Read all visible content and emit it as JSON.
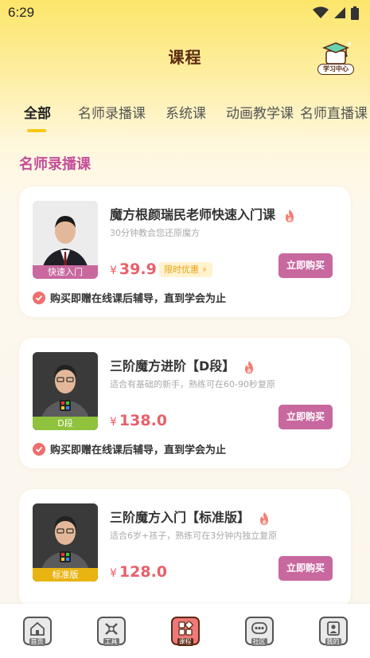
{
  "status": {
    "time": "6:29"
  },
  "header": {
    "title": "课程",
    "study_center_label": "学习中心"
  },
  "tabs": [
    {
      "label": "全部",
      "active": true
    },
    {
      "label": "名师录播课",
      "active": false
    },
    {
      "label": "系统课",
      "active": false
    },
    {
      "label": "动画教学课",
      "active": false
    },
    {
      "label": "名师直播课",
      "active": false
    }
  ],
  "section": {
    "title": "名师录播课"
  },
  "courses": [
    {
      "title": "魔方根颜瑞民老师快速入门课",
      "subtitle": "30分钟教会您还原魔方",
      "price": "39.9",
      "currency": "¥",
      "promo": "限时优惠",
      "tag": "快速入门",
      "tag_color": "#c8689f",
      "buy_label": "立即购买",
      "bonus": "购买即赠在线课后辅导，直到学会为止"
    },
    {
      "title": "三阶魔方进阶【D段】",
      "subtitle": "适合有基础的新手，熟练可在60-90秒复原",
      "price": "138.0",
      "currency": "¥",
      "tag": "D段",
      "tag_color": "#8fc23d",
      "buy_label": "立即购买",
      "bonus": "购买即赠在线课后辅导，直到学会为止"
    },
    {
      "title": "三阶魔方入门【标准版】",
      "subtitle": "适合6岁+孩子，熟练可在3分钟内独立复原",
      "price": "128.0",
      "currency": "¥",
      "tag": "标准版",
      "tag_color": "#e9b312",
      "buy_label": "立即购买"
    }
  ],
  "bottom_nav": [
    {
      "label": "首页",
      "icon": "home-icon",
      "active": false
    },
    {
      "label": "工具",
      "icon": "tools-icon",
      "active": false
    },
    {
      "label": "课程",
      "icon": "course-icon",
      "active": true
    },
    {
      "label": "社区",
      "icon": "community-icon",
      "active": false
    },
    {
      "label": "我的",
      "icon": "profile-icon",
      "active": false
    }
  ],
  "colors": {
    "accent_pink": "#c8689f",
    "price_red": "#e8606a",
    "tab_indicator": "#f6c915",
    "title_brown": "#5a2a12"
  }
}
